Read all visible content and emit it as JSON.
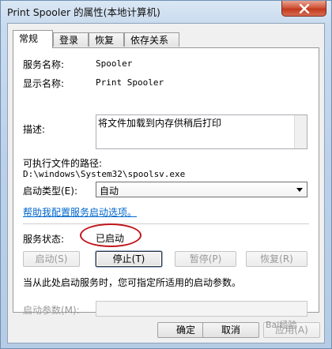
{
  "window": {
    "title": "Print Spooler 的属性(本地计算机)"
  },
  "tabs": [
    {
      "label": "常规"
    },
    {
      "label": "登录"
    },
    {
      "label": "恢复"
    },
    {
      "label": "依存关系"
    }
  ],
  "general": {
    "service_name_label": "服务名称:",
    "service_name_value": "Spooler",
    "display_name_label": "显示名称:",
    "display_name_value": "Print Spooler",
    "description_label": "描述:",
    "description_value": "将文件加载到内存供稍后打印",
    "exe_path_label": "可执行文件的路径:",
    "exe_path_value": "D:\\windows\\System32\\spoolsv.exe",
    "startup_type_label": "启动类型(E):",
    "startup_type_value": "自动",
    "help_link": "帮助我配置服务启动选项。",
    "status_label": "服务状态:",
    "status_value": "已启动",
    "start_button": "启动(S)",
    "stop_button": "停止(T)",
    "pause_button": "暂停(P)",
    "resume_button": "恢复(R)",
    "start_hint": "当从此处启动服务时，您可指定所适用的启动参数。",
    "start_params_label": "启动参数(M):",
    "start_params_value": ""
  },
  "footer": {
    "ok_button": "确定",
    "cancel_button": "取消",
    "apply_button": "应用(A)"
  },
  "watermark": "Bai经验"
}
